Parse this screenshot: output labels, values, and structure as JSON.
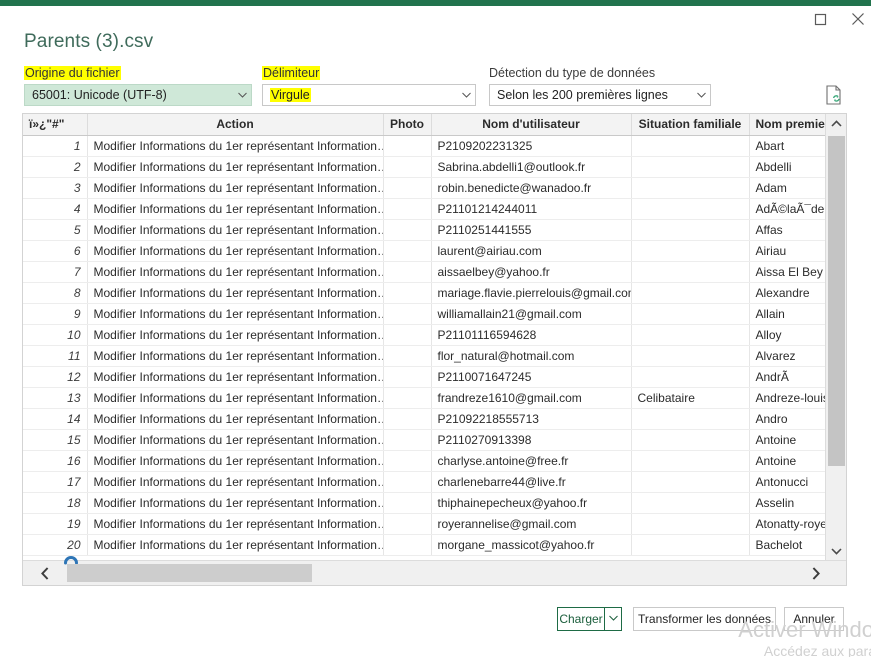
{
  "window": {
    "accent_color": "#21734d",
    "restore_icon": "restore-window-icon",
    "close_icon": "close-window-icon"
  },
  "header": {
    "file_title": "Parents (3).csv"
  },
  "fields": {
    "file_origin": {
      "label": "Origine du fichier",
      "label_highlighted": true,
      "value": "65001: Unicode (UTF-8)",
      "background_color": "#cfe8d8"
    },
    "delimiter": {
      "label": "Délimiteur",
      "label_highlighted": true,
      "value": "Virgule",
      "value_highlighted": true
    },
    "data_type_detection": {
      "label": "Détection du type de données",
      "value": "Selon les 200 premières lignes"
    },
    "refresh_icon": "file-refresh-icon",
    "highlight_color": "#ffff00"
  },
  "preview": {
    "columns": [
      "ï»¿\"#\"",
      "Action",
      "Photo",
      "Nom d'utilisateur",
      "Situation familiale",
      "Nom premier rep"
    ],
    "rows": [
      {
        "idx": "1",
        "action": "Modifier Informations du 1er représentant Information…",
        "photo": "",
        "mail": "P2109202231325",
        "situation": "",
        "nom": "Abart"
      },
      {
        "idx": "2",
        "action": "Modifier Informations du 1er représentant Information…",
        "photo": "",
        "mail": "Sabrina.abdelli1@outlook.fr",
        "situation": "",
        "nom": "Abdelli"
      },
      {
        "idx": "3",
        "action": "Modifier Informations du 1er représentant Information…",
        "photo": "",
        "mail": "robin.benedicte@wanadoo.fr",
        "situation": "",
        "nom": "Adam"
      },
      {
        "idx": "4",
        "action": "Modifier Informations du 1er représentant Information…",
        "photo": "",
        "mail": "P21101214244011",
        "situation": "",
        "nom": "AdÃ©laÃ¯de"
      },
      {
        "idx": "5",
        "action": "Modifier Informations du 1er représentant Information…",
        "photo": "",
        "mail": "P2110251441555",
        "situation": "",
        "nom": "Affas"
      },
      {
        "idx": "6",
        "action": "Modifier Informations du 1er représentant Information…",
        "photo": "",
        "mail": "laurent@airiau.com",
        "situation": "",
        "nom": "Airiau"
      },
      {
        "idx": "7",
        "action": "Modifier Informations du 1er représentant Information…",
        "photo": "",
        "mail": "aissaelbey@yahoo.fr",
        "situation": "",
        "nom": "Aissa El Bey"
      },
      {
        "idx": "8",
        "action": "Modifier Informations du 1er représentant Information…",
        "photo": "",
        "mail": "mariage.flavie.pierrelouis@gmail.com",
        "situation": "",
        "nom": "Alexandre"
      },
      {
        "idx": "9",
        "action": "Modifier Informations du 1er représentant Information…",
        "photo": "",
        "mail": "williamallain21@gmail.com",
        "situation": "",
        "nom": "Allain"
      },
      {
        "idx": "10",
        "action": "Modifier Informations du 1er représentant Information…",
        "photo": "",
        "mail": "P21101116594628",
        "situation": "",
        "nom": "Alloy"
      },
      {
        "idx": "11",
        "action": "Modifier Informations du 1er représentant Information…",
        "photo": "",
        "mail": "flor_natural@hotmail.com",
        "situation": "",
        "nom": "Alvarez"
      },
      {
        "idx": "12",
        "action": "Modifier Informations du 1er représentant Information…",
        "photo": "",
        "mail": "P2110071647245",
        "situation": "",
        "nom": "AndrÃ"
      },
      {
        "idx": "13",
        "action": "Modifier Informations du 1er représentant Information…",
        "photo": "",
        "mail": "frandreze1610@gmail.com",
        "situation": "Celibataire",
        "nom": "Andreze-louison"
      },
      {
        "idx": "14",
        "action": "Modifier Informations du 1er représentant Information…",
        "photo": "",
        "mail": "P21092218555713",
        "situation": "",
        "nom": "Andro"
      },
      {
        "idx": "15",
        "action": "Modifier Informations du 1er représentant Information…",
        "photo": "",
        "mail": "P2110270913398",
        "situation": "",
        "nom": "Antoine"
      },
      {
        "idx": "16",
        "action": "Modifier Informations du 1er représentant Information…",
        "photo": "",
        "mail": "charlyse.antoine@free.fr",
        "situation": "",
        "nom": "Antoine"
      },
      {
        "idx": "17",
        "action": "Modifier Informations du 1er représentant Information…",
        "photo": "",
        "mail": "charlenebarre44@live.fr",
        "situation": "",
        "nom": "Antonucci"
      },
      {
        "idx": "18",
        "action": "Modifier Informations du 1er représentant Information…",
        "photo": "",
        "mail": "thiphainepecheux@yahoo.fr",
        "situation": "",
        "nom": "Asselin"
      },
      {
        "idx": "19",
        "action": "Modifier Informations du 1er représentant Information…",
        "photo": "",
        "mail": "royerannelise@gmail.com",
        "situation": "",
        "nom": "Atonatty-royer"
      },
      {
        "idx": "20",
        "action": "Modifier Informations du 1er représentant Information…",
        "photo": "",
        "mail": "morgane_massicot@yahoo.fr",
        "situation": "",
        "nom": "Bachelot"
      }
    ]
  },
  "footer": {
    "load_label": "Charger",
    "load_split_icon": "chevron-down-icon",
    "transform_label": "Transformer les données",
    "cancel_label": "Annuler"
  },
  "watermark": {
    "line1": "Activer Windo",
    "line2": "Accédez aux para"
  }
}
